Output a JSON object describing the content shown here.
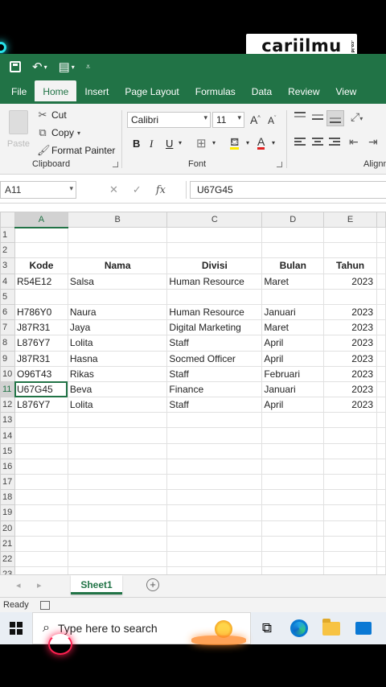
{
  "watermark": {
    "text": "cariilmu",
    "tag": ".co.id"
  },
  "app": {
    "tabs": [
      {
        "label": "File"
      },
      {
        "label": "Home"
      },
      {
        "label": "Insert"
      },
      {
        "label": "Page Layout"
      },
      {
        "label": "Formulas"
      },
      {
        "label": "Data"
      },
      {
        "label": "Review"
      },
      {
        "label": "View"
      }
    ],
    "active_tab": "Home",
    "accent_color": "#217346"
  },
  "ribbon": {
    "clipboard": {
      "paste": "Paste",
      "cut": "Cut",
      "copy": "Copy",
      "format_painter": "Format Painter",
      "group_label": "Clipboard"
    },
    "font": {
      "font_name": "Calibri",
      "font_size": "11",
      "grow": "A",
      "shrink": "A",
      "bold": "B",
      "italic": "I",
      "underline": "U",
      "font_color": "A",
      "group_label": "Font"
    },
    "alignment": {
      "group_label": "Alignm"
    }
  },
  "formula_bar": {
    "name_box": "A11",
    "fx": "fx",
    "content": "U67G45"
  },
  "grid": {
    "columns": [
      "A",
      "B",
      "C",
      "D",
      "E"
    ],
    "selected_cell": "A11",
    "rows": [
      {
        "n": "1",
        "cells": [
          "",
          "",
          "",
          "",
          ""
        ]
      },
      {
        "n": "2",
        "cells": [
          "",
          "",
          "",
          "",
          ""
        ]
      },
      {
        "n": "3",
        "cells": [
          "Kode",
          "Nama",
          "Divisi",
          "Bulan",
          "Tahun"
        ],
        "header": true
      },
      {
        "n": "4",
        "cells": [
          "R54E12",
          "Salsa",
          "Human Resource",
          "Maret",
          "2023"
        ]
      },
      {
        "n": "5",
        "cells": [
          "",
          "",
          "",
          "",
          ""
        ]
      },
      {
        "n": "6",
        "cells": [
          "H786Y0",
          "Naura",
          "Human Resource",
          "Januari",
          "2023"
        ]
      },
      {
        "n": "7",
        "cells": [
          "J87R31",
          "Jaya",
          "Digital Marketing",
          "Maret",
          "2023"
        ]
      },
      {
        "n": "8",
        "cells": [
          "L876Y7",
          "Lolita",
          "Staff",
          "April",
          "2023"
        ]
      },
      {
        "n": "9",
        "cells": [
          "J87R31",
          "Hasna",
          "Socmed Officer",
          "April",
          "2023"
        ]
      },
      {
        "n": "10",
        "cells": [
          "O96T43",
          "Rikas",
          "Staff",
          "Februari",
          "2023"
        ]
      },
      {
        "n": "11",
        "cells": [
          "U67G45",
          "Beva",
          "Finance",
          "Januari",
          "2023"
        ]
      },
      {
        "n": "12",
        "cells": [
          "L876Y7",
          "Lolita",
          "Staff",
          "April",
          "2023"
        ]
      },
      {
        "n": "13",
        "cells": [
          "",
          "",
          "",
          "",
          ""
        ]
      },
      {
        "n": "14",
        "cells": [
          "",
          "",
          "",
          "",
          ""
        ]
      },
      {
        "n": "15",
        "cells": [
          "",
          "",
          "",
          "",
          ""
        ]
      },
      {
        "n": "16",
        "cells": [
          "",
          "",
          "",
          "",
          ""
        ]
      },
      {
        "n": "17",
        "cells": [
          "",
          "",
          "",
          "",
          ""
        ]
      },
      {
        "n": "18",
        "cells": [
          "",
          "",
          "",
          "",
          ""
        ]
      },
      {
        "n": "19",
        "cells": [
          "",
          "",
          "",
          "",
          ""
        ]
      },
      {
        "n": "20",
        "cells": [
          "",
          "",
          "",
          "",
          ""
        ]
      },
      {
        "n": "21",
        "cells": [
          "",
          "",
          "",
          "",
          ""
        ]
      },
      {
        "n": "22",
        "cells": [
          "",
          "",
          "",
          "",
          ""
        ]
      },
      {
        "n": "23",
        "cells": [
          "",
          "",
          "",
          "",
          ""
        ]
      }
    ]
  },
  "sheets": {
    "active": "Sheet1",
    "add_icon": "+"
  },
  "status": {
    "text": "Ready"
  },
  "taskbar": {
    "search_placeholder": "Type here to search"
  }
}
